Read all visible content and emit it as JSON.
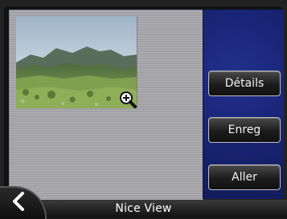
{
  "header": {},
  "actions": {
    "details_label": "Détails",
    "save_label": "Enreg",
    "go_label": "Aller"
  },
  "footer": {
    "title": "Nice View"
  },
  "icons": {
    "zoom": "zoom-in-icon",
    "back": "chevron-left-icon"
  },
  "colors": {
    "right_panel": "#1a2678",
    "left_panel": "#a7a7ac",
    "button_border": "#bfbfbf"
  }
}
